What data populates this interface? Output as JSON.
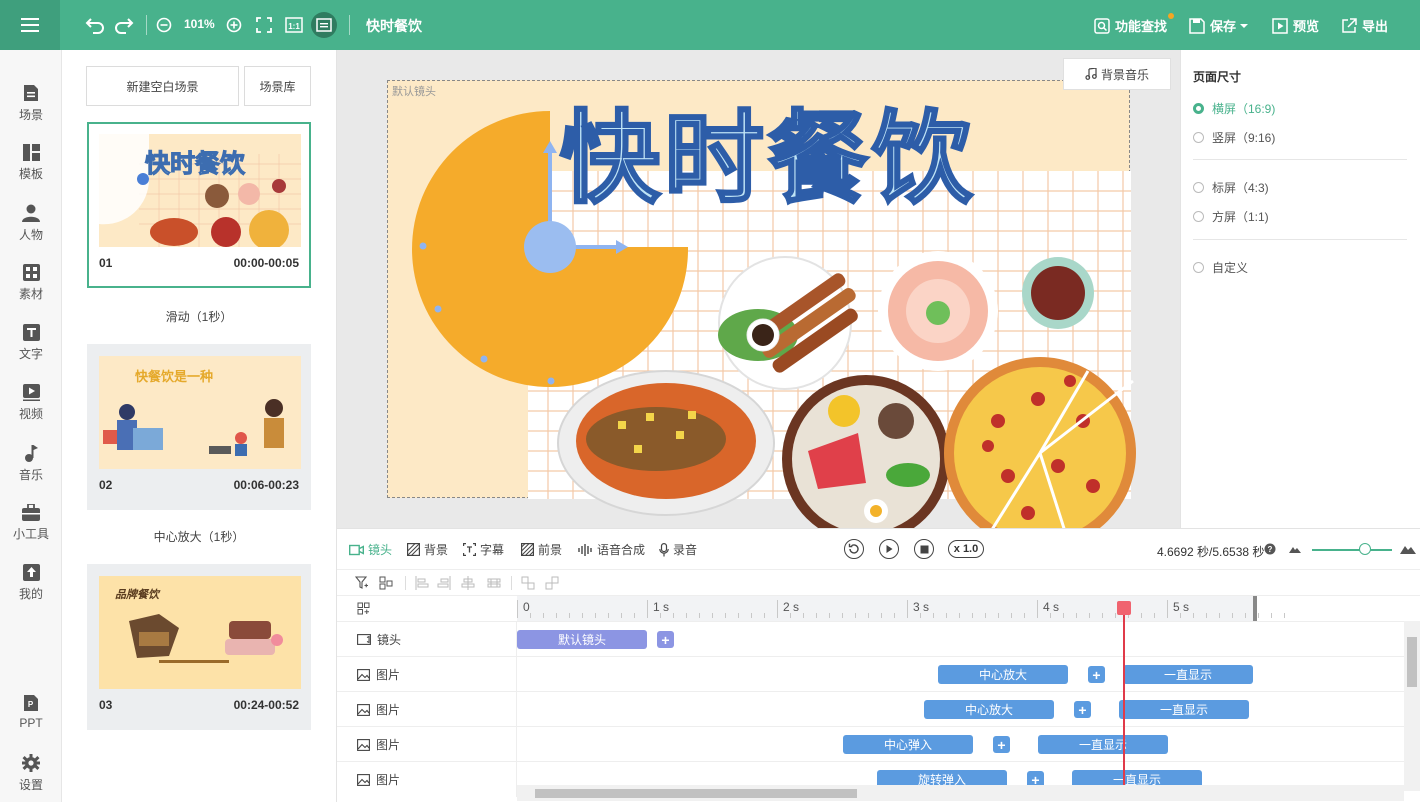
{
  "topbar": {
    "zoom": "101%",
    "project_title": "快时餐饮",
    "find_label": "功能查找",
    "save_label": "保存",
    "preview_label": "预览",
    "export_label": "导出"
  },
  "nav": [
    {
      "label": "场景",
      "icon": "scene-icon"
    },
    {
      "label": "模板",
      "icon": "template-icon"
    },
    {
      "label": "人物",
      "icon": "person-icon"
    },
    {
      "label": "素材",
      "icon": "material-icon"
    },
    {
      "label": "文字",
      "icon": "text-icon"
    },
    {
      "label": "视频",
      "icon": "video-icon"
    },
    {
      "label": "音乐",
      "icon": "music-icon"
    },
    {
      "label": "小工具",
      "icon": "toolbox-icon"
    },
    {
      "label": "我的",
      "icon": "upload-icon"
    },
    {
      "label": "PPT",
      "icon": "ppt-icon"
    },
    {
      "label": "设置",
      "icon": "gear-icon"
    }
  ],
  "scene_panel": {
    "new_blank": "新建空白场景",
    "library": "场景库",
    "scenes": [
      {
        "num": "01",
        "time": "00:00-00:05",
        "transition": "滑动（1秒）",
        "thumb_title": "快时餐饮"
      },
      {
        "num": "02",
        "time": "00:06-00:23",
        "transition": "中心放大（1秒）",
        "thumb_title": "快餐饮是一种"
      },
      {
        "num": "03",
        "time": "00:24-00:52",
        "thumb_title": "品牌餐饮"
      }
    ]
  },
  "canvas": {
    "bgm_label": "背景音乐",
    "lens_label": "默认镜头",
    "title": "快时餐饮"
  },
  "right_panel": {
    "title": "页面尺寸",
    "options": [
      {
        "label": "横屏（16:9)",
        "selected": true
      },
      {
        "label": "竖屏（9:16)",
        "selected": false
      },
      {
        "label": "标屏（4:3)",
        "selected": false
      },
      {
        "label": "方屏（1:1)",
        "selected": false
      },
      {
        "label": "自定义",
        "selected": false
      }
    ]
  },
  "timeline": {
    "tabs": [
      {
        "label": "镜头",
        "active": true,
        "icon": "camera-icon"
      },
      {
        "label": "背景",
        "active": false,
        "icon": "background-icon"
      },
      {
        "label": "字幕",
        "active": false,
        "icon": "subtitle-icon"
      },
      {
        "label": "前景",
        "active": false,
        "icon": "foreground-icon"
      },
      {
        "label": "语音合成",
        "active": false,
        "icon": "voice-icon"
      },
      {
        "label": "录音",
        "active": false,
        "icon": "mic-icon"
      }
    ],
    "speed": "x 1.0",
    "time_readout": "4.6692 秒/5.6538 秒",
    "ruler_labels": [
      "0",
      "1 s",
      "2 s",
      "3 s",
      "4 s",
      "5 s"
    ],
    "tracks": [
      {
        "label": "镜头",
        "clips": [
          "默认镜头"
        ]
      },
      {
        "label": "图片",
        "clips": [
          "中心放大",
          "一直显示"
        ]
      },
      {
        "label": "图片",
        "clips": [
          "中心放大",
          "一直显示"
        ]
      },
      {
        "label": "图片",
        "clips": [
          "中心弹入",
          "一直显示"
        ]
      },
      {
        "label": "图片",
        "clips": [
          "旋转弹入",
          "一直显示"
        ]
      }
    ],
    "plus": "+"
  },
  "colors": {
    "accent": "#48b28c",
    "clip": "#5b9be0",
    "lens_clip": "#8c95e3",
    "playhead": "#e03b4a",
    "canvas_bg": "#fde9c6",
    "clock": "#f5ab2b"
  }
}
